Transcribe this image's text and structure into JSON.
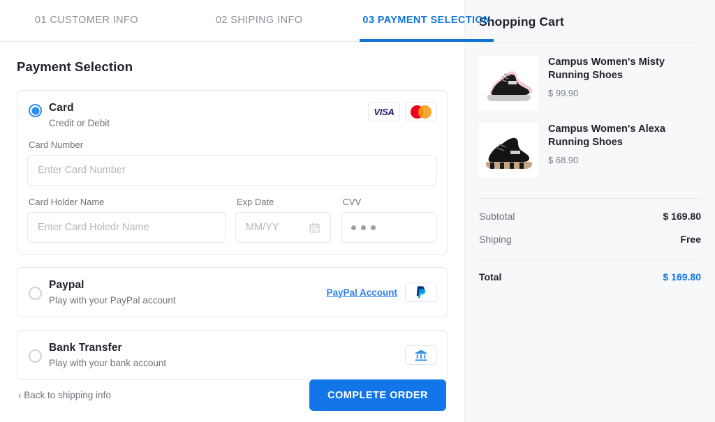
{
  "steps": [
    {
      "label": "01 CUSTOMER INFO",
      "active": false
    },
    {
      "label": "02 SHIPING INFO",
      "active": false
    },
    {
      "label": "03 PAYMENT SELECTION",
      "active": true
    }
  ],
  "payment": {
    "section_title": "Payment Selection",
    "card": {
      "name": "Card",
      "subtitle": "Credit or Debit",
      "selected": true,
      "brands": [
        "visa-logo",
        "mastercard-logo"
      ],
      "visa_text": "VISA",
      "fields": {
        "card_number_label": "Card Number",
        "card_number_placeholder": "Enter Card Number",
        "card_number_value": "",
        "holder_label": "Card Holder Name",
        "holder_placeholder": "Enter Card Holedr Name",
        "holder_value": "",
        "exp_label": "Exp Date",
        "exp_placeholder": "MM/YY",
        "exp_value": "",
        "cvv_label": "CVV",
        "cvv_value": "•••"
      }
    },
    "paypal": {
      "name": "Paypal",
      "subtitle": "Play with your PayPal account",
      "selected": false,
      "link_label": "PayPal Account",
      "icon": "paypal-logo"
    },
    "bank": {
      "name": "Bank Transfer",
      "subtitle": "Play with your bank account",
      "selected": false,
      "icon": "bank-logo"
    }
  },
  "footer": {
    "back_label": "‹ Back to shipping info",
    "submit_label": "COMPLETE ORDER"
  },
  "cart": {
    "title": "Shopping Cart",
    "items": [
      {
        "name": "Campus Women's Misty Running Shoes",
        "price": "$ 99.90",
        "thumb": "black-sneaker-gray-sole"
      },
      {
        "name": "Campus Women's Alexa Running Shoes",
        "price": "$ 68.90",
        "thumb": "black-sneaker-rosegold-sole"
      }
    ],
    "totals": [
      {
        "label": "Subtotal",
        "value": "$ 169.80"
      },
      {
        "label": "Shiping",
        "value": "Free"
      }
    ],
    "grand_total": {
      "label": "Total",
      "value": "$ 169.80"
    }
  },
  "colors": {
    "accent": "#1275e8",
    "active_step": "#1275d6",
    "radio_on": "#2d8cf0",
    "link": "#2d7ff0",
    "panel_bg": "#f7f8f9"
  }
}
